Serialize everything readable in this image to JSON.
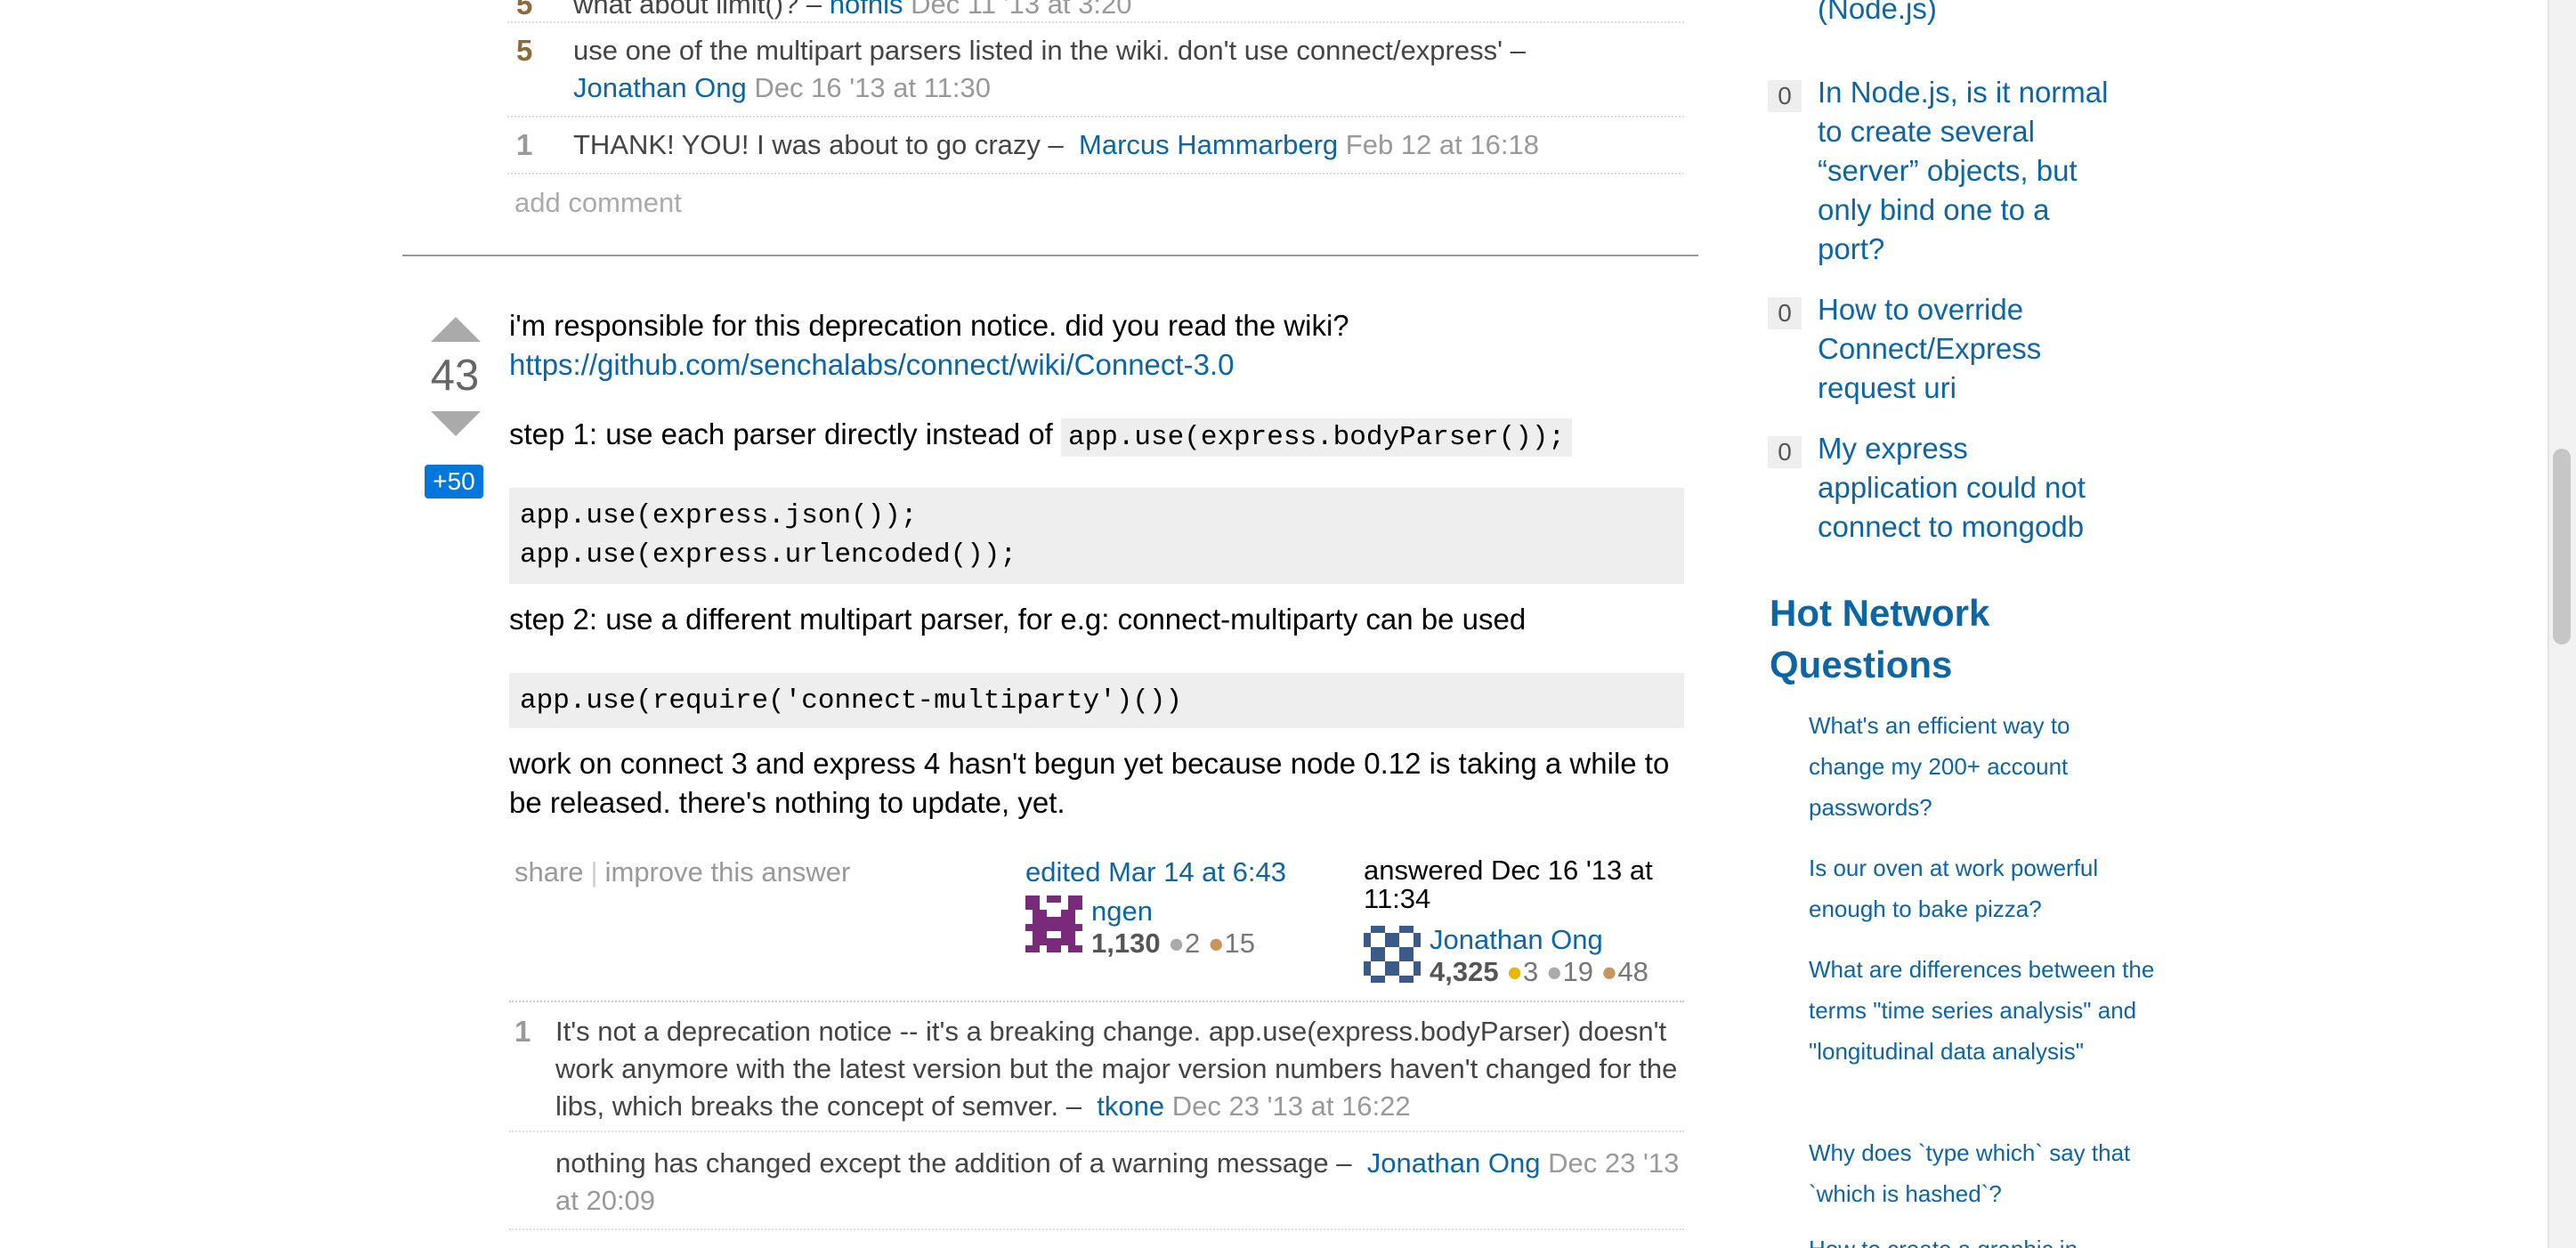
{
  "comments_top": [
    {
      "score": "5",
      "text": "what about limit()?",
      "user": "hofnis",
      "date": "Dec 11 '13 at 3:20"
    },
    {
      "score": "5",
      "text": "use one of the multipart parsers listed in the wiki. don't use connect/express'",
      "user": "Jonathan Ong",
      "date": "Dec 16 '13 at 11:30"
    },
    {
      "score": "1",
      "text": "THANK! YOU! I was about to go crazy",
      "user": "Marcus Hammarberg",
      "date": "Feb 12 at 16:18"
    }
  ],
  "comment_dash": "–",
  "add_comment": "add comment",
  "answer": {
    "votes": "43",
    "bounty": "+50",
    "intro": "i'm responsible for this deprecation notice. did you read the wiki?",
    "wiki_link": "https://github.com/senchalabs/connect/wiki/Connect-3.0",
    "step1_text": "step 1: use each parser directly instead of",
    "step1_code": "app.use(express.bodyParser());",
    "code_block_1": "app.use(express.json());\napp.use(express.urlencoded());",
    "step2_text": "step 2: use a different multipart parser, for e.g: connect-multiparty can be used",
    "code_block_2": "app.use(require('connect-multiparty')())",
    "closing": "work on connect 3 and express 4 hasn't begun yet because node 0.12 is taking a while to be released. there's nothing to update, yet.",
    "share": "share",
    "improve": "improve this answer",
    "edited": {
      "label": "edited Mar 14 at 6:43",
      "user": "ngen",
      "rep": "1,130",
      "silver": "2",
      "bronze": "15"
    },
    "answered": {
      "label": "answered Dec 16 '13 at 11:34",
      "user": "Jonathan Ong",
      "rep": "4,325",
      "gold": "3",
      "silver": "19",
      "bronze": "48"
    }
  },
  "answer_comments": [
    {
      "score": "1",
      "text": "It's not a deprecation notice -- it's a breaking change. app.use(express.bodyParser) doesn't work anymore with the latest version but the major version numbers haven't changed for the libs, which breaks the concept of semver.",
      "user": "tkone",
      "date": "Dec 23 '13 at 16:22"
    },
    {
      "score": "",
      "text": "nothing has changed except the addition of a warning message",
      "user": "Jonathan Ong",
      "date": "Dec 23 '13 at 20:09"
    }
  ],
  "related": [
    {
      "score": "",
      "title": "directory in Connect (Node.js)"
    },
    {
      "score": "0",
      "title": "In Node.js, is it normal to create several “server” objects, but only bind one to a port?"
    },
    {
      "score": "0",
      "title": "How to override Connect/Express request uri"
    },
    {
      "score": "0",
      "title": "My express application could not connect to mongodb"
    }
  ],
  "hot_network": {
    "title": "Hot Network Questions",
    "items": [
      "What's an efficient way to change my 200+ account passwords?",
      "Is our oven at work powerful enough to bake pizza?",
      "What are differences between the terms \"time series analysis\" and \"longitudinal data analysis\"",
      "Why does `type which` say that `which is hashed`?",
      "How to create a graphic in Python"
    ]
  },
  "colors": {
    "link": "#0c65a5",
    "bounty": "#0077dd",
    "muted": "#999999"
  }
}
